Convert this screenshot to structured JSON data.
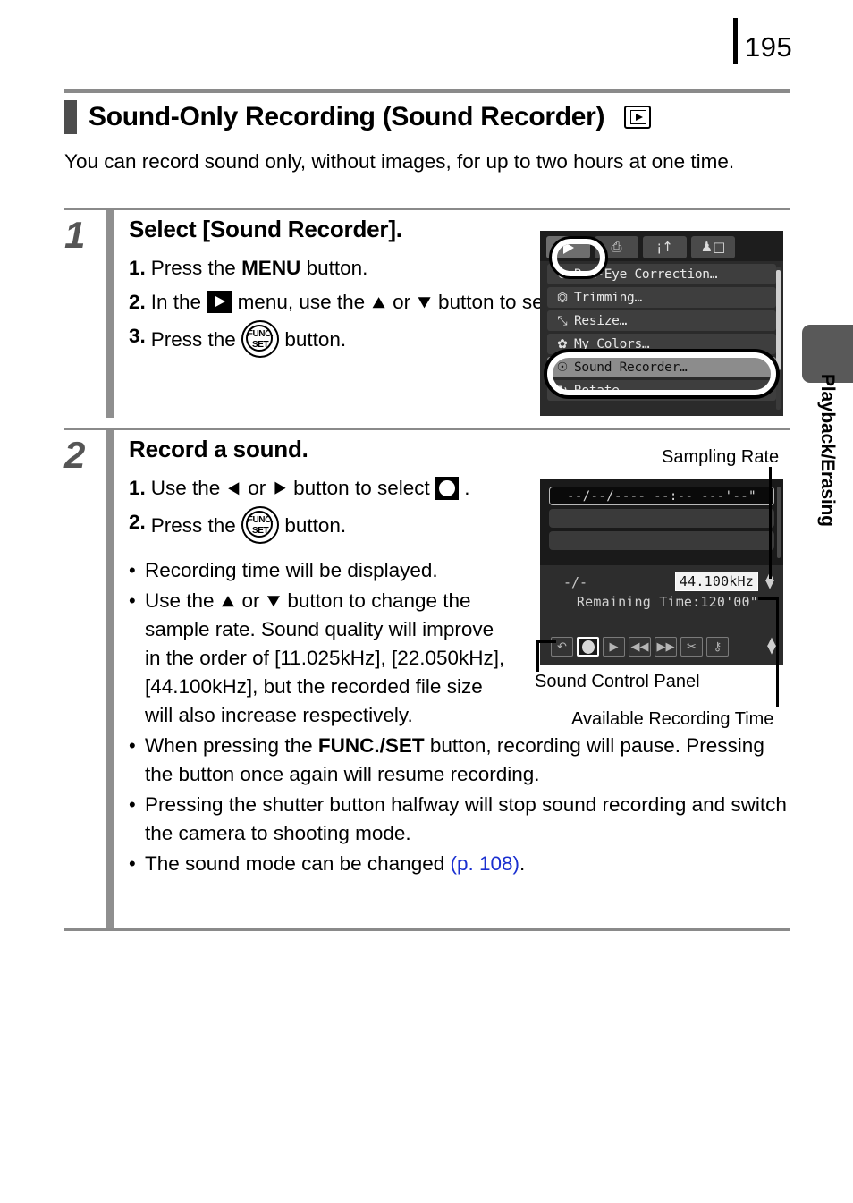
{
  "page": {
    "number": "195",
    "side_tab_label": "Playback/Erasing"
  },
  "section": {
    "title": "Sound-Only Recording (Sound Recorder)",
    "title_icon": "playback-icon",
    "intro": "You can record sound only, without images, for up to two hours at one time."
  },
  "steps": [
    {
      "number": "1",
      "title": "Select [Sound Recorder].",
      "sub_steps": [
        {
          "idx": "1.",
          "pre": "Press the ",
          "bold": "MENU",
          "post": " button."
        },
        {
          "idx": "2.",
          "pre": "In the ",
          "mid": " menu, use the ",
          "mid2": " or ",
          "post": " button to select ",
          "post2": " ."
        },
        {
          "idx": "3.",
          "pre": "Press the ",
          "post": " button."
        }
      ]
    },
    {
      "number": "2",
      "title": "Record a sound.",
      "sub_steps": [
        {
          "idx": "1.",
          "pre": "Use the ",
          "mid": " or ",
          "mid2": " button to select ",
          "post": " ."
        },
        {
          "idx": "2.",
          "pre": "Press the ",
          "post": " button."
        }
      ],
      "bullets": [
        {
          "text": "Recording time will be displayed."
        },
        {
          "pre": "Use the ",
          "mid": " or ",
          "post": " button to change the sample rate. Sound quality will improve in the order of [11.025kHz], [22.050kHz], [44.100kHz], but the recorded file size will also increase respectively."
        },
        {
          "pre": "When pressing the ",
          "bold": "FUNC./SET",
          "post": " button, recording will pause. Pressing the button once again will resume recording."
        },
        {
          "text": "Pressing the shutter button halfway will stop sound recording and switch the camera to shooting mode."
        },
        {
          "pre": "The sound mode can be changed ",
          "link": "(p. 108)",
          "post": "."
        }
      ]
    }
  ],
  "menu_screen": {
    "tabs": [
      {
        "name": "playback-tab",
        "glyph": "",
        "active": true
      },
      {
        "name": "print-tab",
        "glyph": "⎙",
        "active": false
      },
      {
        "name": "settings-tab",
        "glyph": "♁↑",
        "active": false
      },
      {
        "name": "my-camera-tab",
        "glyph": "♟□",
        "active": false
      }
    ],
    "items": [
      {
        "icon": "⊘",
        "label": "Red-Eye Correction…",
        "selected": false
      },
      {
        "icon": "⌐",
        "label": "Trimming…",
        "selected": false
      },
      {
        "icon": "⤡",
        "label": "Resize…",
        "selected": false
      },
      {
        "icon": "✿",
        "label": "My Colors…",
        "selected": false
      },
      {
        "icon": "⌇",
        "label": "Sound Recorder…",
        "selected": true
      },
      {
        "icon": "↻",
        "label": "Rotate…",
        "selected": false
      }
    ]
  },
  "recorder_screen": {
    "timestamp_placeholder": "--/--/----  --:--   ---'--\"",
    "counter": "-/-",
    "sampling_rate": "44.100kHz",
    "remaining_time": "Remaining Time:120'00\"",
    "controls": [
      {
        "name": "exit-button",
        "glyph": "↶",
        "active": false
      },
      {
        "name": "record-button",
        "glyph": "",
        "active": true
      },
      {
        "name": "play-button",
        "glyph": "▶",
        "active": false
      },
      {
        "name": "rewind-button",
        "glyph": "◀◀",
        "active": false
      },
      {
        "name": "fast-forward-button",
        "glyph": "▶▶",
        "active": false
      },
      {
        "name": "erase-button",
        "glyph": "✄",
        "active": false
      },
      {
        "name": "protect-button",
        "glyph": "⚷",
        "active": false
      }
    ]
  },
  "callouts": {
    "sampling_rate": "Sampling Rate",
    "sound_control_panel": "Sound Control Panel",
    "available_recording_time": "Available Recording Time"
  },
  "colors": {
    "link": "#1a2fd0",
    "rule": "#8a8a8a",
    "step_bar": "#8f8f8f",
    "side_tab": "#595959"
  }
}
